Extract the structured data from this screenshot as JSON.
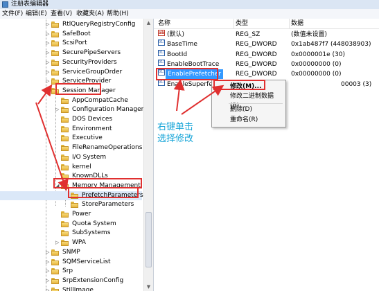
{
  "window": {
    "title": "注册表编辑器"
  },
  "menu": [
    "文件(F)",
    "编辑(E)",
    "查看(V)",
    "收藏夹(A)",
    "帮助(H)"
  ],
  "tree": {
    "items": [
      {
        "label": "RtlQueryRegistryConfig",
        "expander": "▷"
      },
      {
        "label": "SafeBoot",
        "expander": "▷"
      },
      {
        "label": "ScsiPort",
        "expander": "▷"
      },
      {
        "label": "SecurePipeServers",
        "expander": "▷"
      },
      {
        "label": "SecurityProviders",
        "expander": "▷"
      },
      {
        "label": "ServiceGroupOrder",
        "expander": "▷"
      },
      {
        "label": "ServiceProvider",
        "expander": "▷"
      },
      {
        "label": "Session Manager",
        "expander": "◢"
      },
      {
        "label": "AppCompatCache",
        "expander": ""
      },
      {
        "label": "Configuration Manager",
        "expander": "▷"
      },
      {
        "label": "DOS Devices",
        "expander": ""
      },
      {
        "label": "Environment",
        "expander": ""
      },
      {
        "label": "Executive",
        "expander": ""
      },
      {
        "label": "FileRenameOperations",
        "expander": ""
      },
      {
        "label": "I/O System",
        "expander": ""
      },
      {
        "label": "kernel",
        "expander": ""
      },
      {
        "label": "KnownDLLs",
        "expander": ""
      },
      {
        "label": "Memory Management",
        "expander": "◢"
      },
      {
        "label": "PrefetchParameters",
        "expander": ""
      },
      {
        "label": "StoreParameters",
        "expander": ""
      },
      {
        "label": "Power",
        "expander": ""
      },
      {
        "label": "Quota System",
        "expander": ""
      },
      {
        "label": "SubSystems",
        "expander": ""
      },
      {
        "label": "WPA",
        "expander": "▷"
      },
      {
        "label": "SNMP",
        "expander": "▷"
      },
      {
        "label": "SQMServiceList",
        "expander": "▷"
      },
      {
        "label": "Srp",
        "expander": "▷"
      },
      {
        "label": "SrpExtensionConfig",
        "expander": "▷"
      },
      {
        "label": "StillImage",
        "expander": "▷"
      }
    ]
  },
  "list": {
    "columns": [
      "名称",
      "类型",
      "数据"
    ],
    "rows": [
      {
        "icon": "ab",
        "name": "(默认)",
        "type": "REG_SZ",
        "data": "(数值未设置)"
      },
      {
        "icon": "011",
        "name": "BaseTime",
        "type": "REG_DWORD",
        "data": "0x1ab487f7 (448038903)"
      },
      {
        "icon": "011",
        "name": "BootId",
        "type": "REG_DWORD",
        "data": "0x0000001e (30)"
      },
      {
        "icon": "011",
        "name": "EnableBootTrace",
        "type": "REG_DWORD",
        "data": "0x00000000 (0)"
      },
      {
        "icon": "011",
        "name": "EnablePrefetcher",
        "type": "REG_DWORD",
        "data": "0x00000000 (0)"
      },
      {
        "icon": "011",
        "name": "EnableSuperfetch",
        "type": "",
        "data": "00003 (3)"
      }
    ]
  },
  "context_menu": {
    "modify": "修改(M)...",
    "modify_binary": "修改二进制数据(B)...",
    "delete": "删除(D)",
    "rename": "重命名(R)"
  },
  "annotation": {
    "line1": "右键单击",
    "line2": "选择修改"
  },
  "colors": {
    "highlight": "#3399ff",
    "annotation_red": "#e03030",
    "annotation_blue": "#17a5d8"
  }
}
